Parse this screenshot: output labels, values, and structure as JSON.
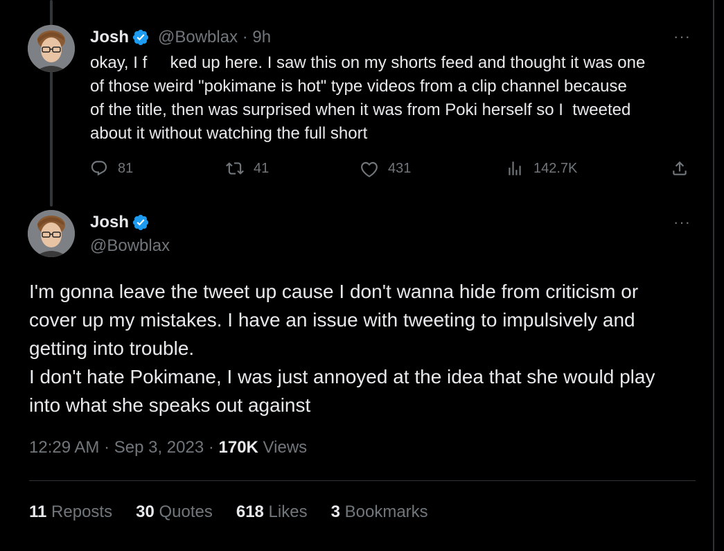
{
  "tweet1": {
    "name": "Josh",
    "handle_time": "@Bowblax · 9h",
    "text_lines": [
      "okay, I f     ked up here. I saw this on my shorts feed and thought it was one",
      "of those weird \"pokimane is hot\" type videos from a clip channel because",
      "of the title, then was surprised when it was from Poki herself so I  tweeted",
      "about it without watching the full short"
    ],
    "replies": "81",
    "reposts": "41",
    "likes": "431",
    "views": "142.7K",
    "more": "···"
  },
  "tweet2": {
    "name": "Josh",
    "handle": "@Bowblax",
    "more": "···",
    "text_lines": [
      "I'm gonna leave the tweet up cause I don't wanna hide from criticism or",
      "cover up my mistakes. I have an issue with tweeting to impulsively and",
      "getting into trouble.",
      "I don't hate Pokimane, I was just annoyed at the idea that she would play",
      "into what she speaks out against"
    ],
    "time_date": "12:29 AM · Sep 3, 2023 · ",
    "views_count": "170K",
    "views_label": " Views",
    "stats": {
      "reposts_count": "11",
      "reposts_label": " Reposts",
      "quotes_count": "30",
      "quotes_label": " Quotes",
      "likes_count": "618",
      "likes_label": " Likes",
      "bookmarks_count": "3",
      "bookmarks_label": " Bookmarks"
    }
  },
  "colors": {
    "background": "#000000",
    "text": "#e7e9ea",
    "muted": "#71767b",
    "verified": "#1d9bf0",
    "divider": "#2f3336"
  },
  "icons": [
    "reply-icon",
    "repost-icon",
    "like-icon",
    "views-icon",
    "share-icon",
    "verified-badge-icon",
    "more-icon"
  ]
}
